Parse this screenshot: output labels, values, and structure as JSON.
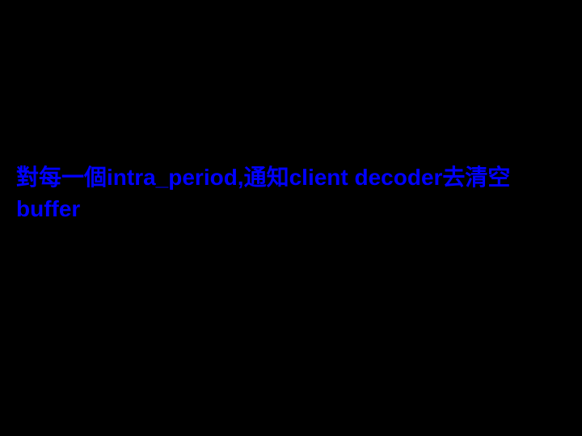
{
  "slide": {
    "content": "對每一個intra_period,通知client decoder去清空buffer"
  }
}
